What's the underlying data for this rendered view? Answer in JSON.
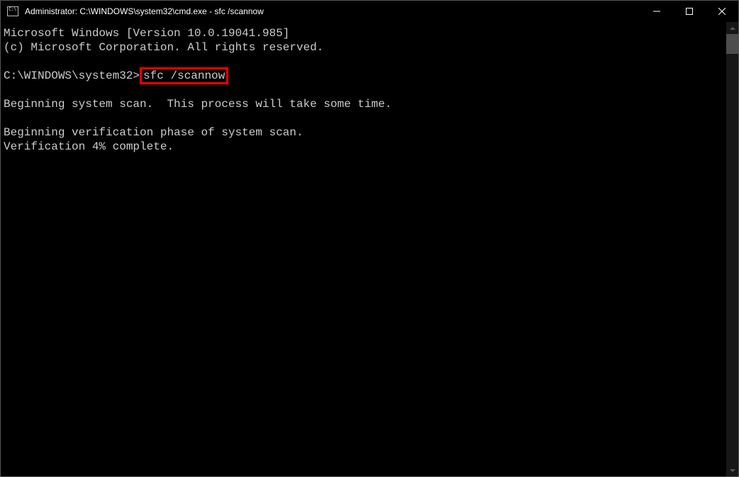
{
  "window": {
    "title": "Administrator: C:\\WINDOWS\\system32\\cmd.exe - sfc  /scannow"
  },
  "console": {
    "line1": "Microsoft Windows [Version 10.0.19041.985]",
    "line2": "(c) Microsoft Corporation. All rights reserved.",
    "blank1": "",
    "prompt": "C:\\WINDOWS\\system32>",
    "command": "sfc /scannow",
    "blank2": "",
    "scan_msg": "Beginning system scan.  This process will take some time.",
    "blank3": "",
    "verify_msg": "Beginning verification phase of system scan.",
    "progress_msg": "Verification 4% complete."
  }
}
